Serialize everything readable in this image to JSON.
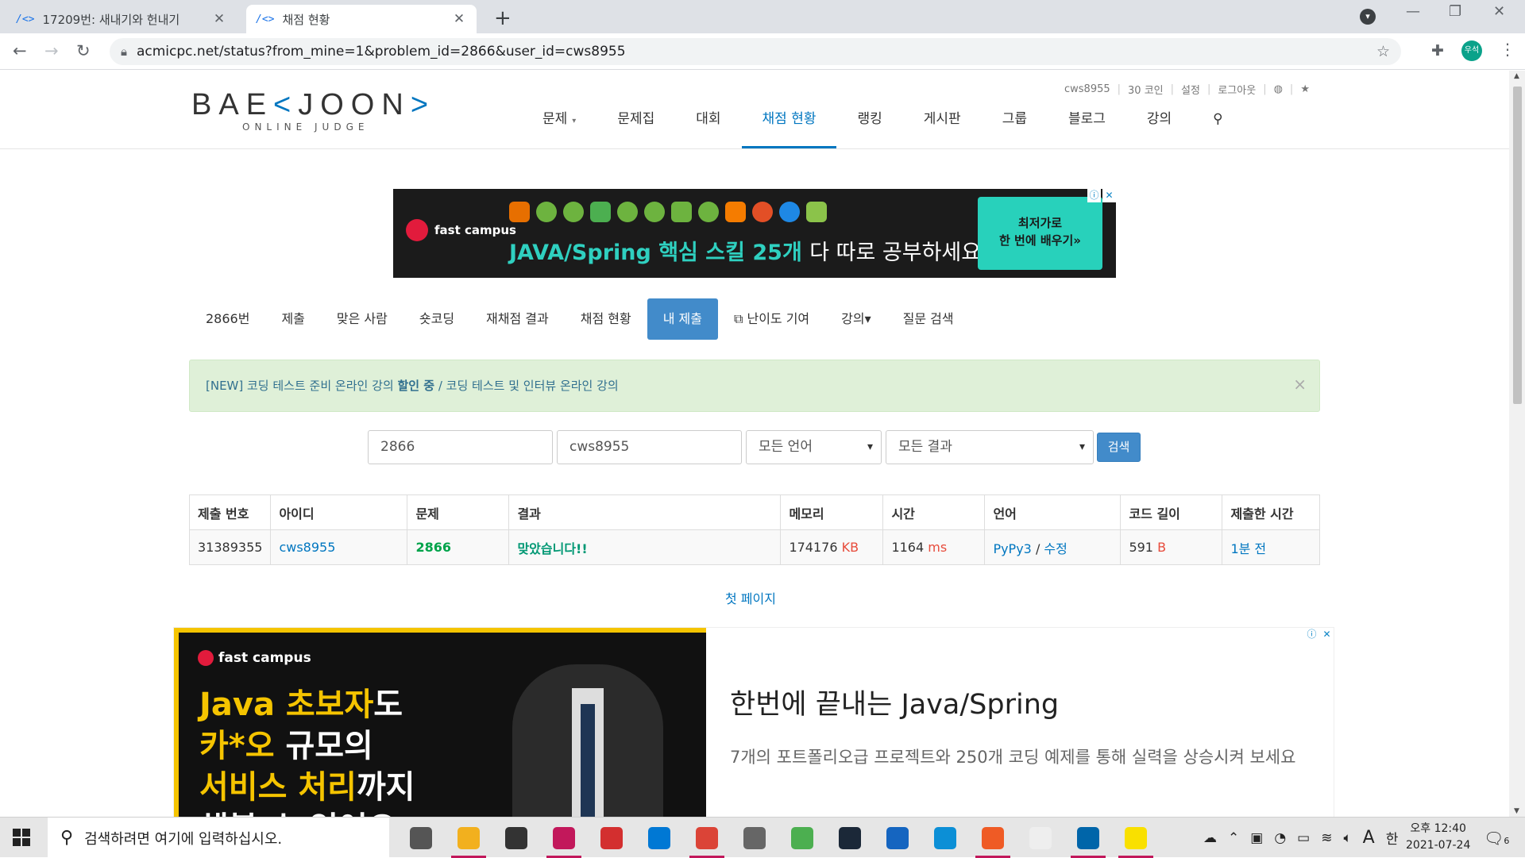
{
  "browser": {
    "tabs": [
      {
        "favicon": "/<>",
        "title": "17209번: 새내기와 헌내기",
        "active": false
      },
      {
        "favicon": "/<>",
        "title": "채점 현황",
        "active": true
      }
    ],
    "url": "acmicpc.net/status?from_mine=1&problem_id=2866&user_id=cws8955",
    "profile_initials": "우석"
  },
  "site": {
    "logo": {
      "pre": "BAE",
      "bracket_l": "<",
      "mid": "JOON",
      "bracket_r": ">",
      "sub": "ONLINE JUDGE"
    },
    "top_links": [
      "cws8955",
      "30 코인",
      "설정",
      "로그아웃"
    ],
    "nav": [
      "문제",
      "문제집",
      "대회",
      "채점 현황",
      "랭킹",
      "게시판",
      "그룹",
      "블로그",
      "강의"
    ],
    "active_nav": "채점 현황"
  },
  "ad_top": {
    "brand": "fast campus",
    "headline_accent": "JAVA/Spring 핵심 스킬 25개",
    "headline_rest": "다 따로 공부하세요?",
    "cta_line1": "최저가로",
    "cta_line2": "한 번에 배우기»"
  },
  "problem_menu": [
    {
      "label": "2866번",
      "active": false
    },
    {
      "label": "제출",
      "active": false
    },
    {
      "label": "맞은 사람",
      "active": false
    },
    {
      "label": "숏코딩",
      "active": false
    },
    {
      "label": "재채점 결과",
      "active": false
    },
    {
      "label": "채점 현황",
      "active": false
    },
    {
      "label": "내 제출",
      "active": true
    },
    {
      "label": "난이도 기여",
      "active": false
    },
    {
      "label": "강의▾",
      "active": false
    },
    {
      "label": "질문 검색",
      "active": false
    }
  ],
  "alert": {
    "pre": "[NEW] 코딩 테스트 준비 온라인 강의",
    "bold": "할인 중",
    "post": " / 코딩 테스트 및 인터뷰 온라인 강의"
  },
  "search": {
    "problem_id": "2866",
    "user_id": "cws8955",
    "language": "모든 언어",
    "result": "모든 결과",
    "button": "검색"
  },
  "table": {
    "headers": [
      "제출 번호",
      "아이디",
      "문제",
      "결과",
      "메모리",
      "시간",
      "언어",
      "코드 길이",
      "제출한 시간"
    ],
    "rows": [
      {
        "submission": "31389355",
        "user": "cws8955",
        "problem": "2866",
        "result": "맞았습니다!!",
        "memory": "174176",
        "memory_unit": "KB",
        "time": "1164",
        "time_unit": "ms",
        "language": "PyPy3",
        "edit": "수정",
        "code_length": "591",
        "code_unit": "B",
        "submitted": "1분 전"
      }
    ]
  },
  "pagination": {
    "first_page": "첫 페이지"
  },
  "ad_bottom": {
    "brand": "fast campus",
    "lines": [
      {
        "accent": "Java 초보자",
        "rest": "도"
      },
      {
        "accent": "카*오",
        "rest": " 규모의"
      },
      {
        "accent": "서비스 처리",
        "rest": "까지"
      },
      {
        "accent": "",
        "rest": "해볼 수 있어요"
      }
    ],
    "title": "한번에 끝내는 Java/Spring",
    "desc": "7개의 포트폴리오급 프로젝트와 250개 코딩 예제를 통해 실력을 상승시켜 보세요"
  },
  "taskbar": {
    "search_placeholder": "검색하려면 여기에 입력하십시오.",
    "time": "오후 12:40",
    "date": "2021-07-24",
    "ime": "한",
    "lang_indicator": "A",
    "notif_count": "6",
    "apps": [
      {
        "name": "task-view",
        "color": "#555555"
      },
      {
        "name": "file-explorer",
        "color": "#f2b01e"
      },
      {
        "name": "store",
        "color": "#333333"
      },
      {
        "name": "app-pink",
        "color": "#c2185b"
      },
      {
        "name": "sync-app",
        "color": "#d32f2f"
      },
      {
        "name": "mail",
        "color": "#0078d4"
      },
      {
        "name": "chrome",
        "color": "#db4437"
      },
      {
        "name": "bug-tool",
        "color": "#666666"
      },
      {
        "name": "kite-app",
        "color": "#4caf50"
      },
      {
        "name": "steam",
        "color": "#1b2838"
      },
      {
        "name": "reader",
        "color": "#1565c0"
      },
      {
        "name": "edge",
        "color": "#0c8fd6"
      },
      {
        "name": "postman",
        "color": "#ef5b25"
      },
      {
        "name": "typora",
        "color": "#eeeeee"
      },
      {
        "name": "vscode",
        "color": "#0065a9"
      },
      {
        "name": "kakaotalk",
        "color": "#f9e000"
      }
    ]
  }
}
